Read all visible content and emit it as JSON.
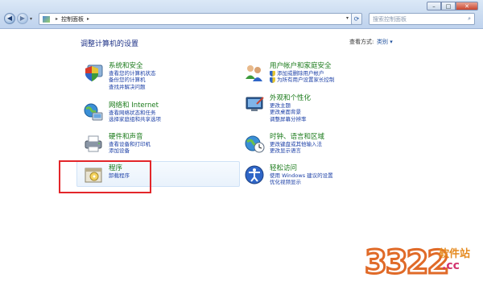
{
  "window": {
    "minimize": "–",
    "maximize": "□",
    "close": "✕"
  },
  "nav": {
    "back_icon": "back-arrow-icon",
    "forward_icon": "forward-arrow-icon"
  },
  "address": {
    "breadcrumb": [
      "控制面板"
    ]
  },
  "search": {
    "placeholder": "搜索控制面板"
  },
  "page": {
    "title": "调整计算机的设置",
    "view_by_label": "查看方式:",
    "view_by_value": "类别 ▾"
  },
  "categories": [
    {
      "title": "系统和安全",
      "icon": "shield-pc-icon",
      "links": [
        {
          "text": "查看您的计算机状态",
          "shield": false
        },
        {
          "text": "备份您的计算机",
          "shield": false
        },
        {
          "text": "查找并解决问题",
          "shield": false
        }
      ]
    },
    {
      "title": "网络和 Internet",
      "icon": "network-icon",
      "links": [
        {
          "text": "查看网络状态和任务",
          "shield": false
        },
        {
          "text": "选择家庭组和共享选项",
          "shield": false
        }
      ]
    },
    {
      "title": "硬件和声音",
      "icon": "printer-icon",
      "links": [
        {
          "text": "查看设备和打印机",
          "shield": false
        },
        {
          "text": "添加设备",
          "shield": false
        }
      ]
    },
    {
      "title": "程序",
      "icon": "programs-icon",
      "links": [
        {
          "text": "卸载程序",
          "shield": false
        }
      ]
    },
    {
      "title": "用户帐户和家庭安全",
      "icon": "users-icon",
      "links": [
        {
          "text": "添加或删除用户帐户",
          "shield": true
        },
        {
          "text": "为所有用户设置家长控制",
          "shield": true
        }
      ]
    },
    {
      "title": "外观和个性化",
      "icon": "appearance-icon",
      "links": [
        {
          "text": "更改主题",
          "shield": false
        },
        {
          "text": "更改桌面背景",
          "shield": false
        },
        {
          "text": "调整屏幕分辨率",
          "shield": false
        }
      ]
    },
    {
      "title": "时钟、语言和区域",
      "icon": "clock-globe-icon",
      "links": [
        {
          "text": "更改键盘或其他输入法",
          "shield": false
        },
        {
          "text": "更改显示语言",
          "shield": false
        }
      ]
    },
    {
      "title": "轻松访问",
      "icon": "ease-of-access-icon",
      "links": [
        {
          "text": "使用 Windows 建议的设置",
          "shield": false
        },
        {
          "text": "优化视频显示",
          "shield": false
        }
      ]
    }
  ],
  "watermark": {
    "number": "3322",
    "text": "软件站",
    ".cc": ".cc"
  },
  "colors": {
    "category_title": "#1a7a1a",
    "link": "#1b3fa6",
    "highlight": "#e3262a"
  }
}
